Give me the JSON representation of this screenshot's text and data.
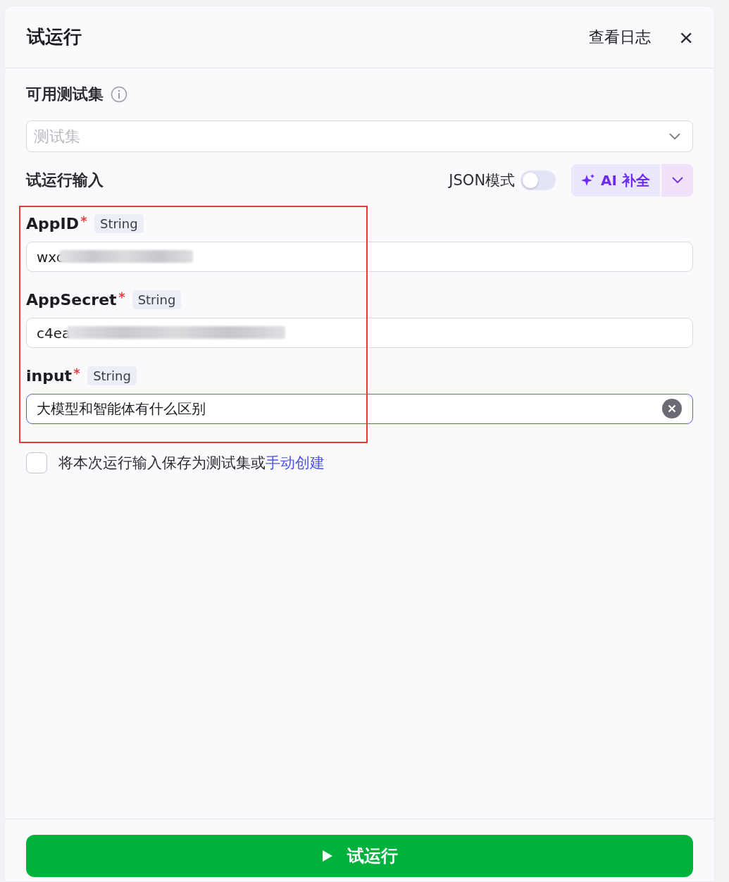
{
  "header": {
    "title": "试运行",
    "log_link": "查看日志",
    "close": "×"
  },
  "test_set": {
    "label": "可用测试集",
    "placeholder": "测试集"
  },
  "inputs_header": {
    "label": "试运行输入",
    "json_mode": {
      "label": "JSON模式",
      "on": false
    },
    "ai_button": "AI 补全"
  },
  "fields": [
    {
      "name": "AppID",
      "required": true,
      "type": "String",
      "value": "wxc",
      "blurred": true,
      "focused": false
    },
    {
      "name": "AppSecret",
      "required": true,
      "type": "String",
      "value": "c4ea",
      "blurred": true,
      "focused": false
    },
    {
      "name": "input",
      "required": true,
      "type": "String",
      "value": "大模型和智能体有什么区别",
      "focused": true
    }
  ],
  "annotation": {
    "kind": "frame",
    "color": "#e5393a"
  },
  "save": {
    "checked": false,
    "text": "将本次运行输入保存为测试集或",
    "link": "手动创建"
  },
  "run_button": {
    "label": "试运行"
  }
}
